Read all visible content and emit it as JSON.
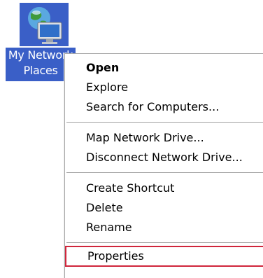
{
  "desktop_icon": {
    "label": "My Network\nPlaces",
    "icon": "network-places-icon",
    "selection_color": "#3a5fc7"
  },
  "context_menu": {
    "groups": [
      [
        {
          "label": "Open",
          "bold": true
        },
        {
          "label": "Explore",
          "bold": false
        },
        {
          "label": "Search for Computers...",
          "bold": false
        }
      ],
      [
        {
          "label": "Map Network Drive...",
          "bold": false
        },
        {
          "label": "Disconnect Network Drive...",
          "bold": false
        }
      ],
      [
        {
          "label": "Create Shortcut",
          "bold": false
        },
        {
          "label": "Delete",
          "bold": false
        },
        {
          "label": "Rename",
          "bold": false
        }
      ],
      [
        {
          "label": "Properties",
          "bold": false,
          "highlighted": true
        }
      ]
    ],
    "highlight_color": "#d0263c"
  }
}
